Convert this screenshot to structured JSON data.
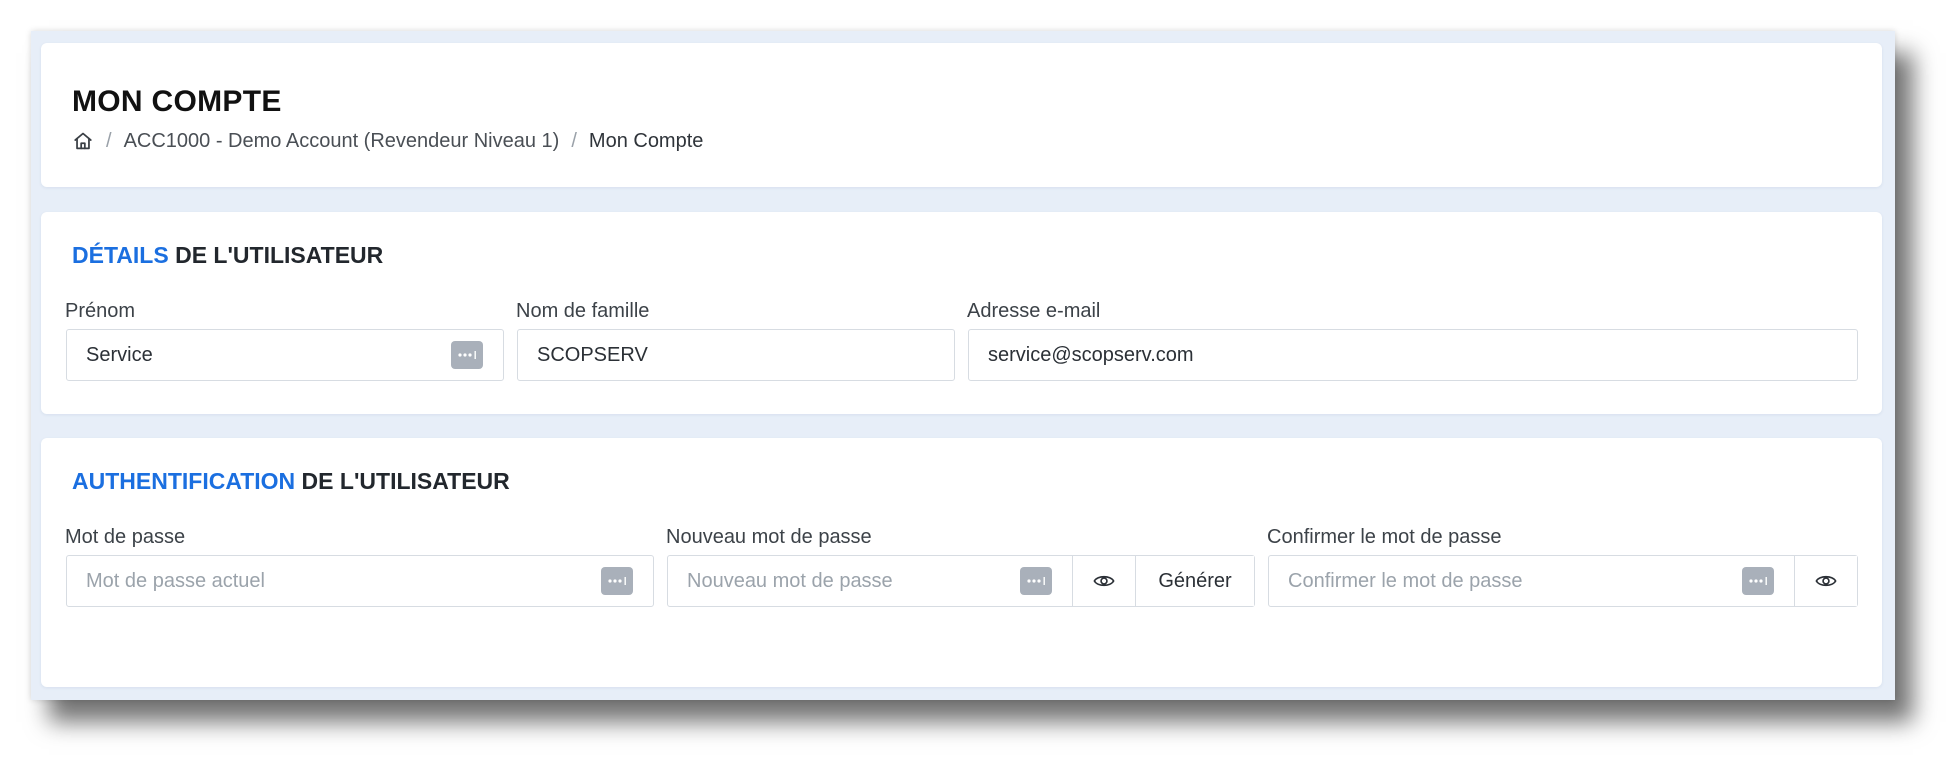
{
  "header": {
    "title": "MON COMPTE",
    "breadcrumb": [
      {
        "label": "ACC1000 - Demo Account (Revendeur Niveau 1)"
      },
      {
        "label": "Mon Compte"
      }
    ],
    "separator": "/"
  },
  "details": {
    "title_accent": "DÉTAILS",
    "title_rest": " DE L'UTILISATEUR",
    "first_name": {
      "label": "Prénom",
      "value": "Service"
    },
    "last_name": {
      "label": "Nom de famille",
      "value": "SCOPSERV"
    },
    "email": {
      "label": "Adresse e-mail",
      "value": "service@scopserv.com"
    }
  },
  "auth": {
    "title_accent": "AUTHENTIFICATION",
    "title_rest": " DE L'UTILISATEUR",
    "password": {
      "label": "Mot de passe",
      "placeholder": "Mot de passe actuel"
    },
    "new_password": {
      "label": "Nouveau mot de passe",
      "placeholder": "Nouveau mot de passe",
      "generate_label": "Générer"
    },
    "confirm_password": {
      "label": "Confirmer le mot de passe",
      "placeholder": "Confirmer le mot de passe"
    }
  },
  "icons": {
    "home": "home-icon",
    "password_manager": "password-dots-icon",
    "show_password": "eye-icon"
  },
  "colors": {
    "accent": "#1b6fe0",
    "background": "#e7eef8",
    "dots_badge": "#a9b0ba"
  }
}
